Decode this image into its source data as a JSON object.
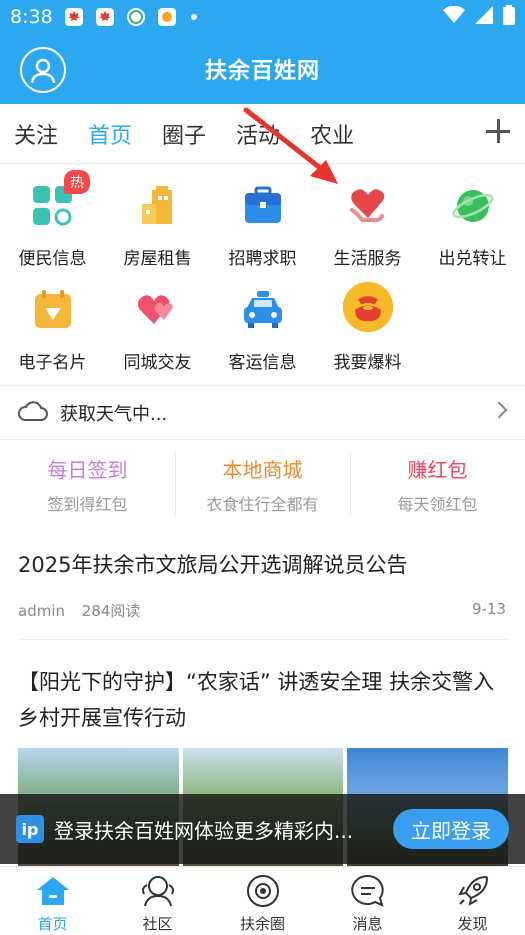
{
  "status_bar": {
    "time": "8:38"
  },
  "header": {
    "title": "扶余百姓网"
  },
  "tabs": [
    {
      "label": "关注"
    },
    {
      "label": "首页"
    },
    {
      "label": "圈子"
    },
    {
      "label": "活动"
    },
    {
      "label": "农业"
    }
  ],
  "grid": {
    "hot_badge": "热",
    "items": [
      {
        "label": "便民信息",
        "icon": "grid-squares-icon"
      },
      {
        "label": "房屋租售",
        "icon": "building-icon"
      },
      {
        "label": "招聘求职",
        "icon": "briefcase-icon"
      },
      {
        "label": "生活服务",
        "icon": "heart-hand-icon"
      },
      {
        "label": "出兑转让",
        "icon": "planet-icon"
      },
      {
        "label": "电子名片",
        "icon": "card-diamond-icon"
      },
      {
        "label": "同城交友",
        "icon": "hearts-icon"
      },
      {
        "label": "客运信息",
        "icon": "car-icon"
      },
      {
        "label": "我要爆料",
        "icon": "red-bag-icon"
      }
    ]
  },
  "weather": {
    "text": "获取天气中..."
  },
  "promos": [
    {
      "title": "每日签到",
      "subtitle": "签到得红包",
      "color": "#c47de6"
    },
    {
      "title": "本地商城",
      "subtitle": "衣食住行全都有",
      "color": "#ee8a2e"
    },
    {
      "title": "赚红包",
      "subtitle": "每天领红包",
      "color": "#f0455d"
    }
  ],
  "news": [
    {
      "title": "2025年扶余市文旅局公开选调解说员公告",
      "author": "admin",
      "reads": "284阅读",
      "date": "9-13"
    },
    {
      "title": "【阳光下的守护】“农家话” 讲透安全理 扶余交警入乡村开展宣传行动"
    }
  ],
  "login_banner": {
    "logo": "ip",
    "text": "登录扶余百姓网体验更多精彩内...",
    "button": "立即登录"
  },
  "bottom_nav": [
    {
      "label": "首页"
    },
    {
      "label": "社区"
    },
    {
      "label": "扶余圈"
    },
    {
      "label": "消息"
    },
    {
      "label": "发现"
    }
  ],
  "colors": {
    "primary": "#2ba8f0",
    "hot": "#f24a4a"
  }
}
